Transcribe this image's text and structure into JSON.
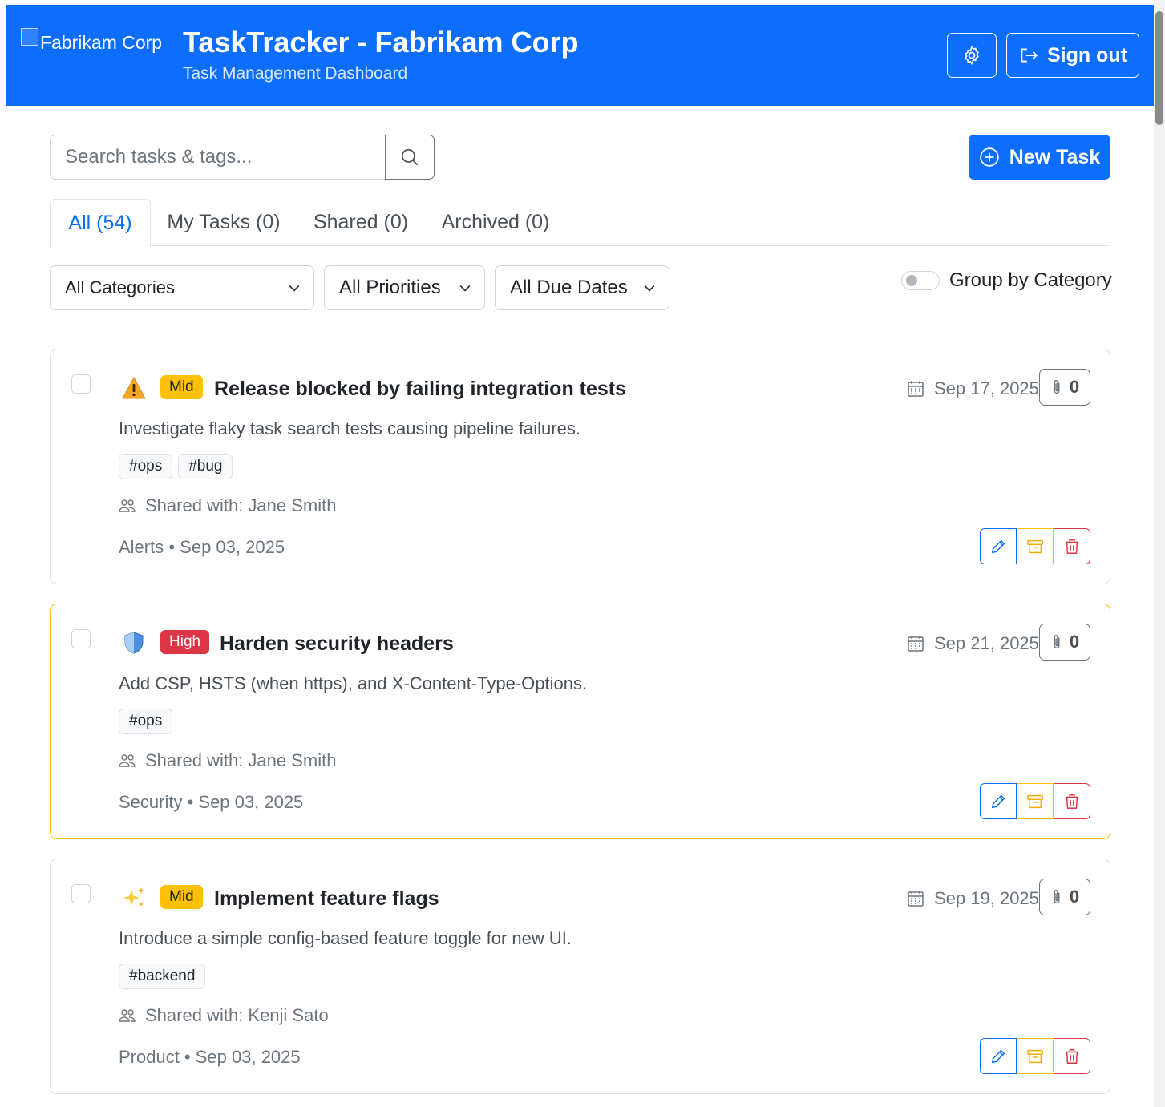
{
  "header": {
    "logo_alt": "Fabrikam Corp",
    "title": "TaskTracker - Fabrikam Corp",
    "subtitle": "Task Management Dashboard",
    "settings_icon": "gear-icon",
    "signout_label": "Sign out",
    "signout_icon": "box-arrow-right-icon",
    "background_color": "#0d6efd"
  },
  "toolbar": {
    "search_placeholder": "Search tasks & tags...",
    "search_icon": "search-icon",
    "new_task_label": "New Task",
    "new_task_icon": "plus-circle-icon"
  },
  "tabs": [
    {
      "label": "All (54)",
      "active": true
    },
    {
      "label": "My Tasks (0)",
      "active": false
    },
    {
      "label": "Shared (0)",
      "active": false
    },
    {
      "label": "Archived (0)",
      "active": false
    }
  ],
  "filters": {
    "category": "All Categories",
    "priority": "All Priorities",
    "due_date": "All Due Dates",
    "group_by_label": "Group by Category",
    "group_by_enabled": false
  },
  "tasks": [
    {
      "icon": "warning-icon",
      "priority": "Mid",
      "title": "Release blocked by failing integration tests",
      "due": "Sep 17, 2025",
      "attachments": "0",
      "description": "Investigate flaky task search tests causing pipeline failures.",
      "tags": [
        "#ops",
        "#bug"
      ],
      "shared_with": "Shared with: Jane Smith",
      "meta": "Alerts • Sep 03, 2025",
      "highlighted": false
    },
    {
      "icon": "shield-icon",
      "priority": "High",
      "title": "Harden security headers",
      "due": "Sep 21, 2025",
      "attachments": "0",
      "description": "Add CSP, HSTS (when https), and X-Content-Type-Options.",
      "tags": [
        "#ops"
      ],
      "shared_with": "Shared with: Jane Smith",
      "meta": "Security • Sep 03, 2025",
      "highlighted": true
    },
    {
      "icon": "sparkles-icon",
      "priority": "Mid",
      "title": "Implement feature flags",
      "due": "Sep 19, 2025",
      "attachments": "0",
      "description": "Introduce a simple config-based feature toggle for new UI.",
      "tags": [
        "#backend"
      ],
      "shared_with": "Shared with: Kenji Sato",
      "meta": "Product • Sep 03, 2025",
      "highlighted": false
    }
  ],
  "colors": {
    "primary": "#0d6efd",
    "warning": "#ffc107",
    "danger": "#dc3545",
    "muted": "#6c757d"
  }
}
